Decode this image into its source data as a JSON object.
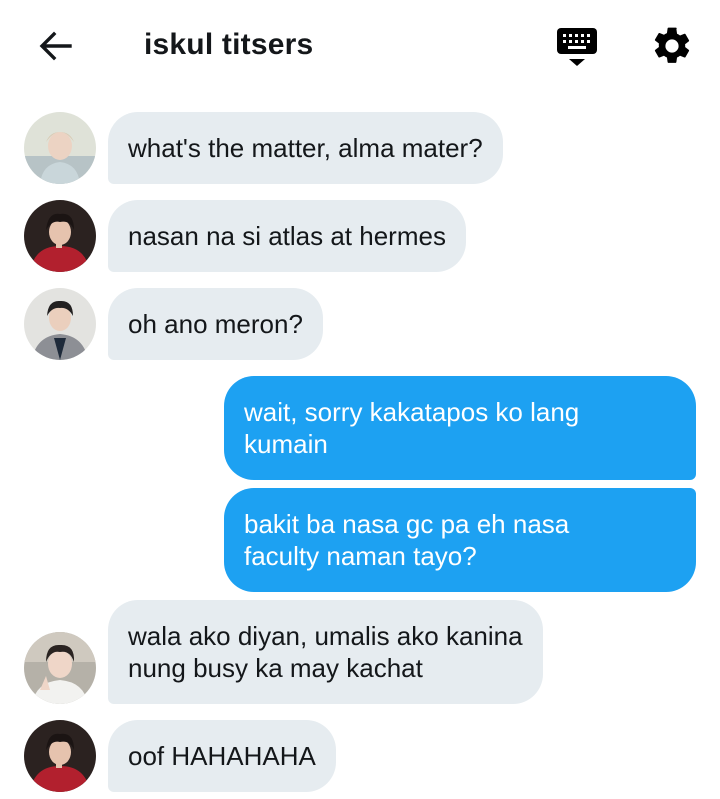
{
  "header": {
    "title": "iskul titsers",
    "back_icon": "arrow-left-icon",
    "keyboard_icon": "keyboard-icon",
    "settings_icon": "gear-icon"
  },
  "colors": {
    "incoming_bubble": "#e6ecf0",
    "outgoing_bubble": "#1da1f2",
    "text": "#14171a"
  },
  "messages": [
    {
      "direction": "incoming",
      "avatar": "avatar-1",
      "lines": [
        "what's the matter, alma mater?"
      ]
    },
    {
      "direction": "incoming",
      "avatar": "avatar-2",
      "lines": [
        "nasan na si atlas at hermes"
      ]
    },
    {
      "direction": "incoming",
      "avatar": "avatar-3",
      "lines": [
        "oh ano meron?"
      ]
    },
    {
      "direction": "outgoing",
      "lines": [
        "wait, sorry kakatapos ko lang",
        "kumain"
      ]
    },
    {
      "direction": "outgoing",
      "lines": [
        "bakit ba nasa gc pa eh nasa",
        "faculty naman tayo?"
      ]
    },
    {
      "direction": "incoming",
      "avatar": "avatar-4",
      "lines": [
        "wala ako diyan, umalis ako kanina",
        "nung busy ka may kachat"
      ]
    },
    {
      "direction": "incoming",
      "avatar": "avatar-2",
      "lines": [
        "oof HAHAHAHA"
      ]
    }
  ]
}
